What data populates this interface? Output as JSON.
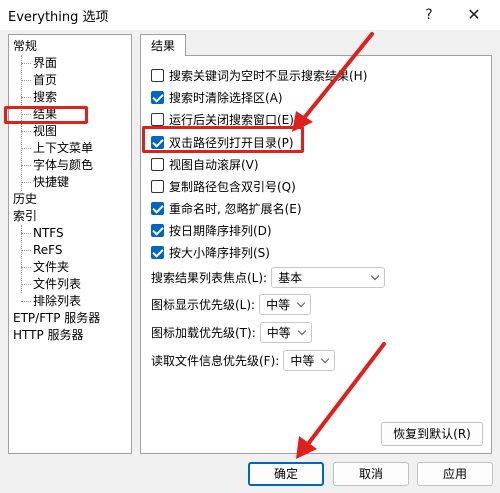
{
  "window": {
    "title": "Everything 选项",
    "help_glyph": "?",
    "close_glyph": "✕"
  },
  "tree": {
    "general": "常规",
    "general_children": [
      "界面",
      "首页",
      "搜索",
      "结果",
      "视图",
      "上下文菜单",
      "字体与颜色",
      "快捷键"
    ],
    "history": "历史",
    "index": "索引",
    "index_children": [
      "NTFS",
      "ReFS",
      "文件夹",
      "文件列表",
      "排除列表"
    ],
    "etp": "ETP/FTP 服务器",
    "http": "HTTP 服务器",
    "selected": "结果"
  },
  "tab": {
    "label": "结果"
  },
  "options": [
    {
      "label": "搜索关键词为空时不显示搜索结果(H)",
      "checked": false
    },
    {
      "label": "搜索时清除选择区(A)",
      "checked": true
    },
    {
      "label": "运行后关闭搜索窗口(E)",
      "checked": false
    },
    {
      "label": "双击路径列打开目录(P)",
      "checked": true
    },
    {
      "label": "视图自动滚屏(V)",
      "checked": false
    },
    {
      "label": "复制路径包含双引号(Q)",
      "checked": false
    },
    {
      "label": "重命名时, 忽略扩展名(E)",
      "checked": true
    },
    {
      "label": "按日期降序排列(D)",
      "checked": true
    },
    {
      "label": "按大小降序排列(S)",
      "checked": true
    }
  ],
  "fields": {
    "focus": {
      "label": "搜索结果列表焦点(L):",
      "value": "基本"
    },
    "icon_priority": {
      "label": "图标显示优先级(L):",
      "value": "中等"
    },
    "icon_load": {
      "label": "图标加载优先级(T):",
      "value": "中等"
    },
    "file_info": {
      "label": "读取文件信息优先级(F):",
      "value": "中等"
    }
  },
  "buttons": {
    "restore": "恢复到默认(R)",
    "ok": "确定",
    "cancel": "取消",
    "apply": "应用"
  },
  "colors": {
    "accent": "#0067c0",
    "annotation": "#e0201a"
  },
  "icons": {
    "checked": "checkmark-icon",
    "dropdown": "chevron-down-icon"
  }
}
